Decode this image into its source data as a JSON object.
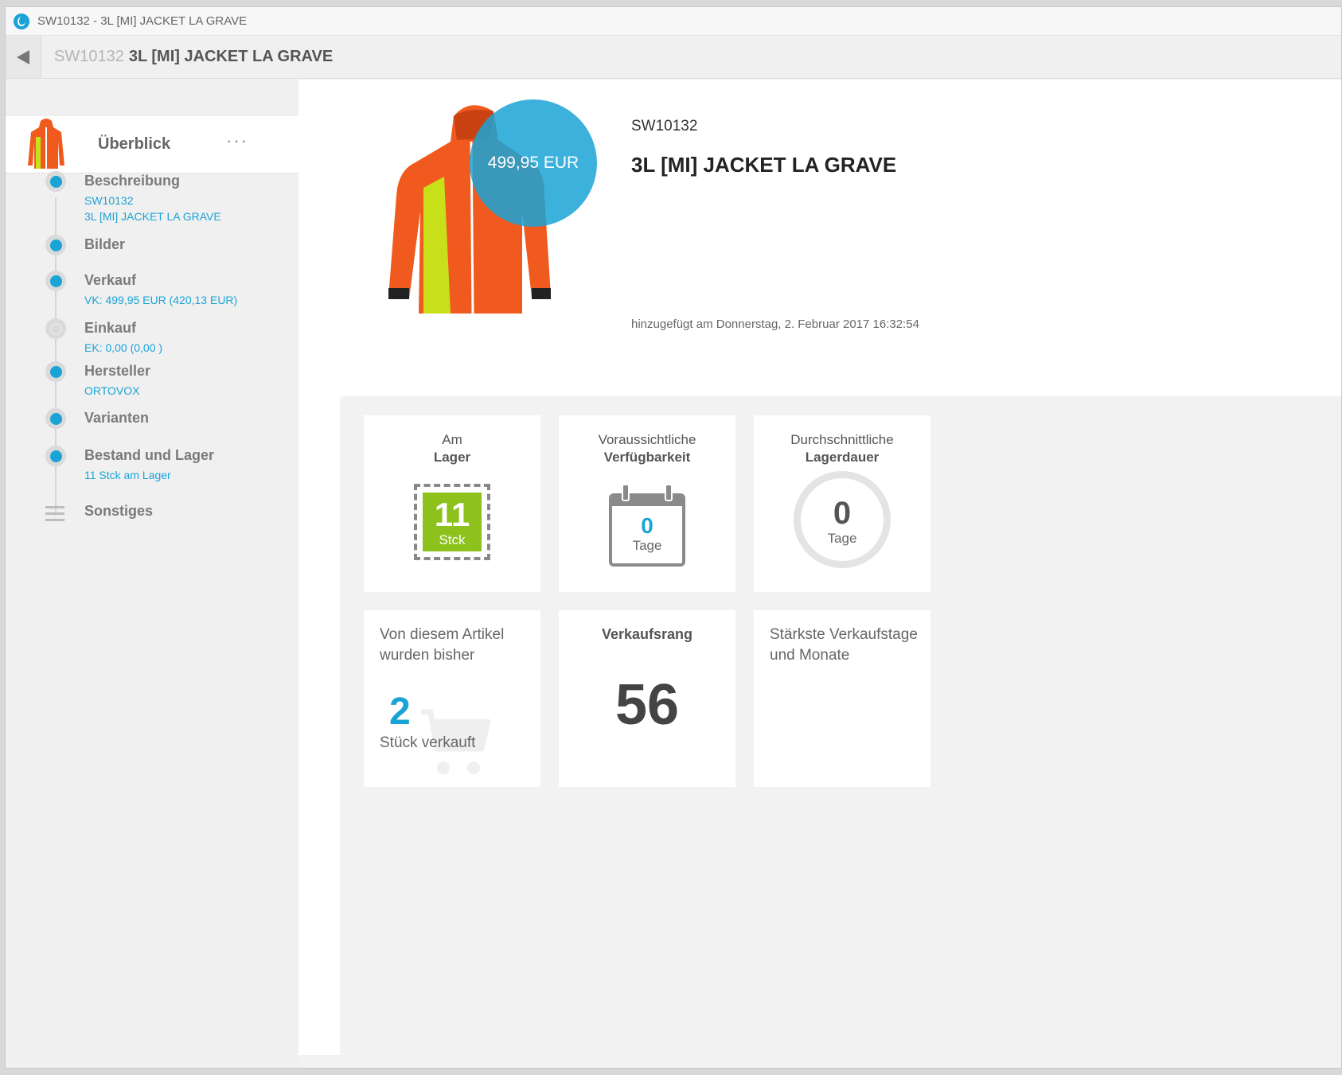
{
  "window": {
    "title": "SW10132 - 3L [MI] JACKET LA GRAVE"
  },
  "header": {
    "number": "SW10132",
    "name": "3L [MI] JACKET LA GRAVE"
  },
  "sidebar": {
    "overview_label": "Überblick",
    "more_label": "···",
    "items": [
      {
        "title": "Beschreibung",
        "subs": [
          "SW10132",
          "3L [MI] JACKET LA GRAVE"
        ],
        "status": "complete"
      },
      {
        "title": "Bilder",
        "subs": [],
        "status": "complete"
      },
      {
        "title": "Verkauf",
        "subs": [
          "VK: 499,95 EUR (420,13 EUR)"
        ],
        "status": "complete"
      },
      {
        "title": "Einkauf",
        "subs": [
          "EK: 0,00  (0,00 )"
        ],
        "status": "incomplete"
      },
      {
        "title": "Hersteller",
        "subs": [
          "ORTOVOX"
        ],
        "status": "complete"
      },
      {
        "title": "Varianten",
        "subs": [],
        "status": "complete"
      },
      {
        "title": "Bestand und Lager",
        "subs": [
          "11 Stck am Lager"
        ],
        "status": "complete"
      },
      {
        "title": "Sonstiges",
        "subs": [],
        "status": "menu"
      }
    ]
  },
  "product": {
    "price": "499,95 EUR",
    "number": "SW10132",
    "name": "3L [MI] JACKET LA GRAVE",
    "added": "hinzugefügt am Donnerstag, 2. Februar 2017 16:32:54"
  },
  "tiles": {
    "stock": {
      "line1": "Am",
      "line2": "Lager",
      "value": "11",
      "unit": "Stck"
    },
    "availability": {
      "line1": "Voraussichtliche",
      "line2": "Verfügbarkeit",
      "value": "0",
      "unit": "Tage"
    },
    "storage": {
      "line1": "Durchschnittliche",
      "line2": "Lagerdauer",
      "value": "0",
      "unit": "Tage"
    },
    "sold": {
      "heading": "Von diesem Artikel wurden bisher",
      "value": "2",
      "unit": "Stück verkauft"
    },
    "rank": {
      "heading": "Verkaufsrang",
      "value": "56"
    },
    "best_days": {
      "heading": "Stärkste Verkaufstage und Monate"
    }
  },
  "colors": {
    "accent": "#1aa3d6",
    "stock_green": "#8dc11c",
    "jacket_orange": "#f05a1e",
    "jacket_yellow": "#c8e01a"
  }
}
